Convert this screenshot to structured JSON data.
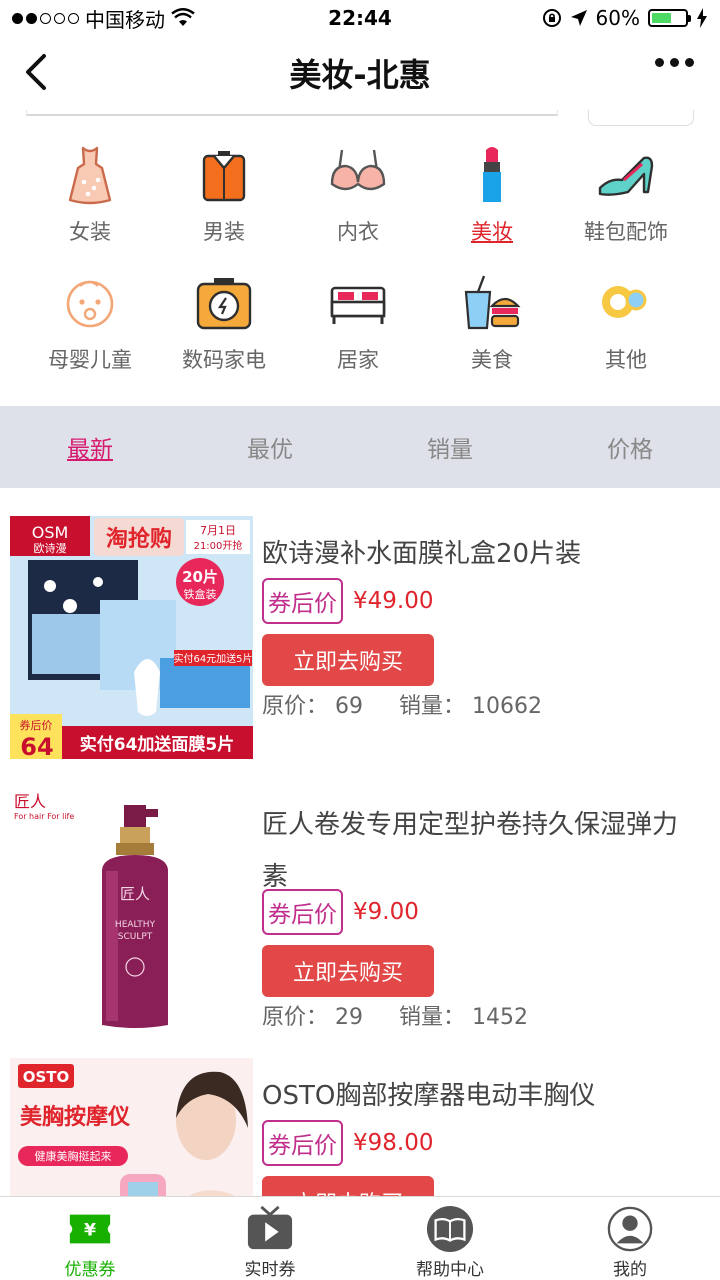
{
  "status_bar": {
    "carrier": "中国移动",
    "time": "22:44",
    "battery_percent": "60%",
    "battery_level": 0.6
  },
  "nav": {
    "title": "美妆-北惠"
  },
  "categories": [
    {
      "label": "女装",
      "icon": "dress-icon"
    },
    {
      "label": "男装",
      "icon": "shirt-icon"
    },
    {
      "label": "内衣",
      "icon": "bra-icon"
    },
    {
      "label": "美妆",
      "icon": "lipstick-icon",
      "active": true
    },
    {
      "label": "鞋包配饰",
      "icon": "high-heel-icon"
    },
    {
      "label": "母婴儿童",
      "icon": "baby-icon"
    },
    {
      "label": "数码家电",
      "icon": "camera-icon"
    },
    {
      "label": "居家",
      "icon": "bed-icon"
    },
    {
      "label": "美食",
      "icon": "burger-drink-icon"
    },
    {
      "label": "其他",
      "icon": "rings-icon"
    }
  ],
  "sort_tabs": [
    {
      "label": "最新",
      "active": true
    },
    {
      "label": "最优"
    },
    {
      "label": "销量"
    },
    {
      "label": "价格"
    }
  ],
  "products": [
    {
      "title": "欧诗漫补水面膜礼盒20片装",
      "coupon_label": "券后价",
      "price": "¥49.00",
      "buy_label": "立即去购买",
      "original_price": "原价：  69",
      "sales": "销量：  10662",
      "image": {
        "brand": "OSM",
        "brand_cn": "欧诗漫",
        "banner": "淘抢购",
        "date": "7月1日",
        "time": "21:00开抢",
        "badge": "20片",
        "badge_sub": "铁盒装",
        "promo_small": "实付64元加送5片",
        "coupon_tag": "券后价",
        "coupon_price": "64",
        "footer": "实付64加送面膜5片"
      }
    },
    {
      "title": "匠人卷发专用定型护卷持久保湿弹力素",
      "coupon_label": "券后价",
      "price": "¥9.00",
      "buy_label": "立即去购买",
      "original_price": "原价：  29",
      "sales": "销量：  1452",
      "image": {
        "brand": "匠人",
        "brand_sub": "For hair For life",
        "bottle_brand": "匠人",
        "bottle_text": "HEALTHY",
        "bottle_sub": "SCULPT"
      }
    },
    {
      "title": "OSTO胸部按摩器电动丰胸仪",
      "coupon_label": "券后价",
      "price": "¥98.00",
      "buy_label": "立即去购买",
      "image": {
        "brand": "OSTO",
        "headline": "美胸按摩仪",
        "tagline": "健康美胸挺起来"
      }
    }
  ],
  "tab_bar": [
    {
      "label": "优惠券",
      "icon": "coupon-icon",
      "active": true
    },
    {
      "label": "实时券",
      "icon": "play-tv-icon"
    },
    {
      "label": "帮助中心",
      "icon": "book-icon"
    },
    {
      "label": "我的",
      "icon": "user-icon"
    }
  ],
  "colors": {
    "accent_red": "#e0242c",
    "buy_button": "#e24848",
    "coupon_border": "#c12f8c",
    "sort_active": "#d61b6f",
    "tab_active": "#17b000",
    "sort_bar_bg": "#dfe1ea"
  }
}
